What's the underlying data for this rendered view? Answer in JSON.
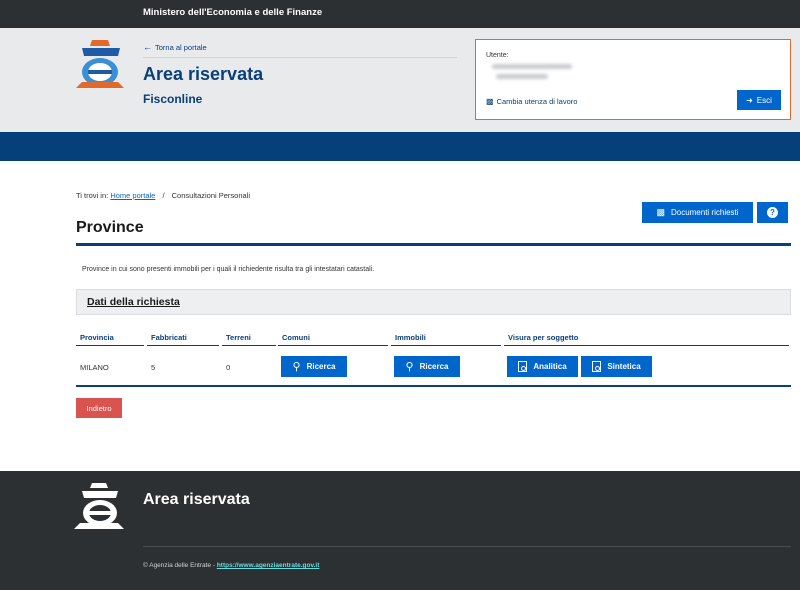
{
  "topbar": {
    "ministry": "Ministero dell'Economia e delle Finanze"
  },
  "header": {
    "back_link": "Torna al portale",
    "title": "Area riservata",
    "subtitle": "Fisconline",
    "user_label": "Utente:",
    "switch_label": "Cambia utenza di lavoro",
    "logout_label": "Esci"
  },
  "breadcrumb": {
    "prefix": "Ti trovi in:",
    "home": "Home portale",
    "separator": "/",
    "current": "Consultazioni Personali"
  },
  "actions": {
    "documents_label": "Documenti richiesti",
    "help_label": "?"
  },
  "page": {
    "title": "Province",
    "intro": "Province in cui sono presenti immobili per i quali il richiedente risulta tra gli intestatari catastali.",
    "section_title": "Dati della richiesta"
  },
  "table": {
    "headers": [
      "Provincia",
      "Fabbricati",
      "Terreni",
      "Comuni",
      "Immobili",
      "Visura per soggetto"
    ],
    "rows": [
      {
        "provincia": "MILANO",
        "fabbricati": "5",
        "terreni": "0",
        "comuni_btn": "Ricerca",
        "immobili_btn": "Ricerca",
        "analitica_btn": "Analitica",
        "sintetica_btn": "Sintetica"
      }
    ]
  },
  "back_button": "Indietro",
  "footer": {
    "title": "Area riservata",
    "copyright": "© Agenzia delle Entrate - ",
    "link": "https://www.agenziaentrate.gov.it"
  },
  "colors": {
    "primary": "#0066cc",
    "navy": "#0a3f7a",
    "danger": "#d9534f",
    "dark": "#2d3033",
    "accent_border": "#e06a2c"
  },
  "icons": [
    "arrow-left-icon",
    "users-icon",
    "logout-icon",
    "archive-icon",
    "help-icon",
    "search-icon",
    "pdf-icon",
    "agency-logo"
  ]
}
